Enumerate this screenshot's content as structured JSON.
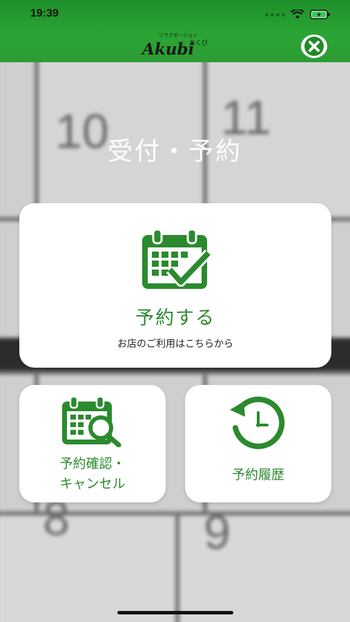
{
  "status_bar": {
    "time": "19:39"
  },
  "header": {
    "logo_small": "リラクゼーション",
    "logo_kana": "あくび",
    "logo_text": "Akubi",
    "close_icon": "close-icon"
  },
  "background": {
    "numbers": [
      "10",
      "11",
      "8",
      "9"
    ]
  },
  "page": {
    "title": "受付・予約"
  },
  "cards": {
    "reserve": {
      "label": "予約する",
      "sub": "お店のご利用はこちらから",
      "icon": "calendar-check-icon"
    },
    "confirm": {
      "line1": "予約確認・",
      "line2": "キャンセル",
      "icon": "calendar-search-icon"
    },
    "history": {
      "label": "予約履歴",
      "icon": "clock-history-icon"
    }
  },
  "colors": {
    "brand_green": "#2b8a2e",
    "header_green": "#2aa534"
  }
}
